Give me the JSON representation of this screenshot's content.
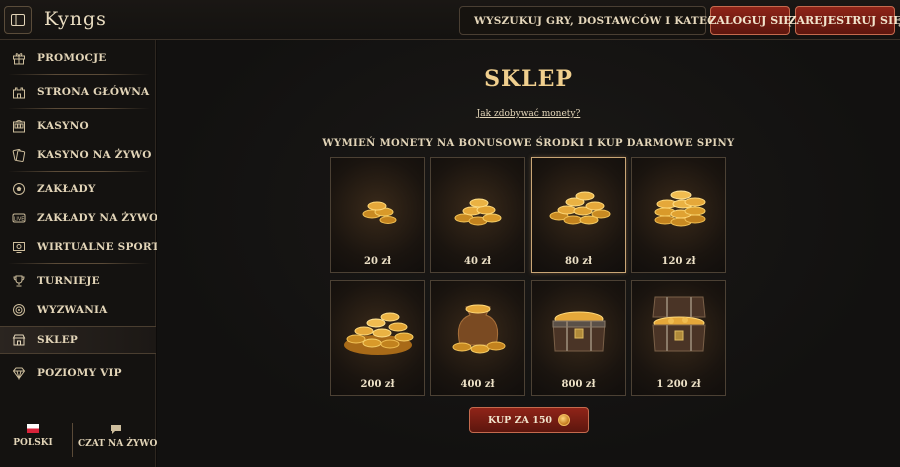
{
  "header": {
    "logo": "Kyngs",
    "search_label": "WYSZUKUJ GRY, DOSTAWCÓW I KATEGORIE",
    "login_label": "ZALOGUJ SIĘ",
    "register_label": "ZAREJESTRUJ SIĘ"
  },
  "sidebar": {
    "items": [
      {
        "label": "PROMOCJE",
        "icon": "gift-icon"
      },
      {
        "label": "STRONA GŁÓWNA",
        "icon": "castle-icon"
      },
      {
        "label": "KASYNO",
        "icon": "slot-machine-icon"
      },
      {
        "label": "KASYNO NA ŻYWO",
        "icon": "cards-icon"
      },
      {
        "label": "ZAKŁADY",
        "icon": "soccer-ball-icon"
      },
      {
        "label": "ZAKŁADY NA ŻYWO",
        "icon": "live-icon"
      },
      {
        "label": "WIRTUALNE SPORTY",
        "icon": "monitor-icon"
      },
      {
        "label": "TURNIEJE",
        "icon": "trophy-icon"
      },
      {
        "label": "WYZWANIA",
        "icon": "target-icon"
      },
      {
        "label": "SKLEP",
        "icon": "shop-icon",
        "active": true
      },
      {
        "label": "POZIOMY VIP",
        "icon": "diamond-icon"
      }
    ],
    "footer": {
      "language_label": "POLSKI",
      "chat_label": "CZAT NA ŻYWO"
    }
  },
  "shop": {
    "title": "SKLEP",
    "how_link": "Jak zdobywać monety?",
    "subtitle": "WYMIEŃ MONETY NA BONUSOWE ŚRODKI I KUP DARMOWE SPINY",
    "packages": [
      {
        "price": "20 zł",
        "icon": "coin-pile-small-icon"
      },
      {
        "price": "40 zł",
        "icon": "coin-pile-icon"
      },
      {
        "price": "80 zł",
        "icon": "coin-stacks-icon",
        "selected": true
      },
      {
        "price": "120 zł",
        "icon": "coin-stacks-large-icon"
      },
      {
        "price": "200 zł",
        "icon": "coin-heap-icon"
      },
      {
        "price": "400 zł",
        "icon": "coin-sack-icon"
      },
      {
        "price": "800 zł",
        "icon": "treasure-chest-icon"
      },
      {
        "price": "1 200 zł",
        "icon": "treasure-chest-open-icon"
      }
    ],
    "buy_label": "KUP ZA 150"
  },
  "colors": {
    "accent_gold": "#f0cf8e",
    "button_red": "#8f2418",
    "background": "#121110"
  }
}
